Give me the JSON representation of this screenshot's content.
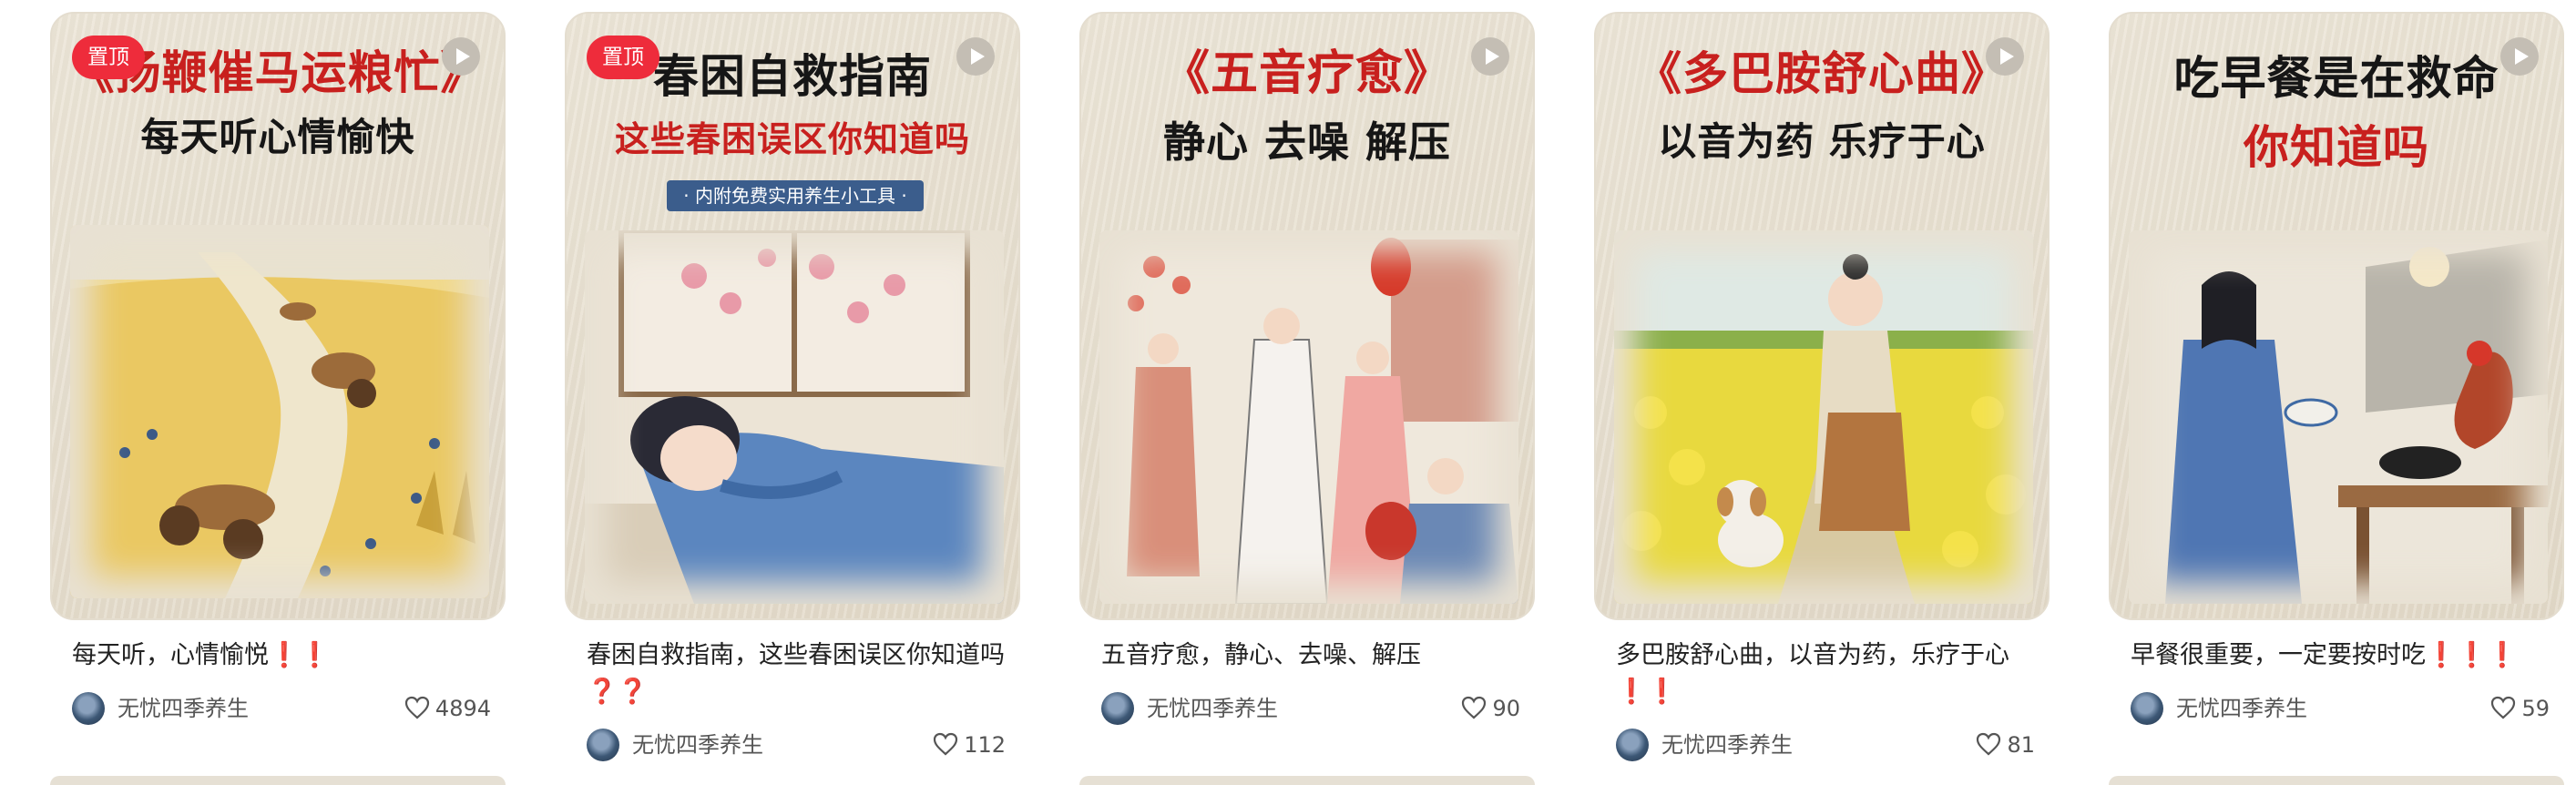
{
  "cards": [
    {
      "pinned": true,
      "pin_label": "置顶",
      "cover_lines": [
        "《扬鞭催马运粮忙》",
        "每天听心情愉快"
      ],
      "caption": "每天听，心情愉悦",
      "caption_emoji": "❗❗",
      "author": "无忧四季养生",
      "likes": "4894",
      "play_icon": "play-icon"
    },
    {
      "pinned": true,
      "pin_label": "置顶",
      "cover_lines": [
        "春困自救指南",
        "这些春困误区你知道吗"
      ],
      "cover_tag": "· 内附免费实用养生小工具 ·",
      "caption": "春困自救指南，这些春困误区你知道吗",
      "caption_emoji": "❓❓",
      "author": "无忧四季养生",
      "likes": "112",
      "play_icon": "play-icon"
    },
    {
      "pinned": false,
      "cover_lines": [
        "《五音疗愈》",
        "静心 去噪 解压"
      ],
      "caption": "五音疗愈，静心、去噪、解压",
      "caption_emoji": "",
      "author": "无忧四季养生",
      "likes": "90",
      "play_icon": "play-icon"
    },
    {
      "pinned": false,
      "cover_lines": [
        "《多巴胺舒心曲》",
        "以音为药 乐疗于心"
      ],
      "caption": "多巴胺舒心曲，以音为药，乐疗于心",
      "caption_emoji": "❗❗",
      "author": "无忧四季养生",
      "likes": "81",
      "play_icon": "play-icon"
    },
    {
      "pinned": false,
      "cover_lines": [
        "吃早餐是在救命",
        "你知道吗"
      ],
      "caption": "早餐很重要，一定要按时吃",
      "caption_emoji": "❗❗❗",
      "author": "无忧四季养生",
      "likes": "59",
      "play_icon": "play-icon"
    }
  ],
  "colors": {
    "pin_badge": "#ee2c3b",
    "cover_title_red": "#c8201e",
    "emphasis": "#e21b2b"
  }
}
